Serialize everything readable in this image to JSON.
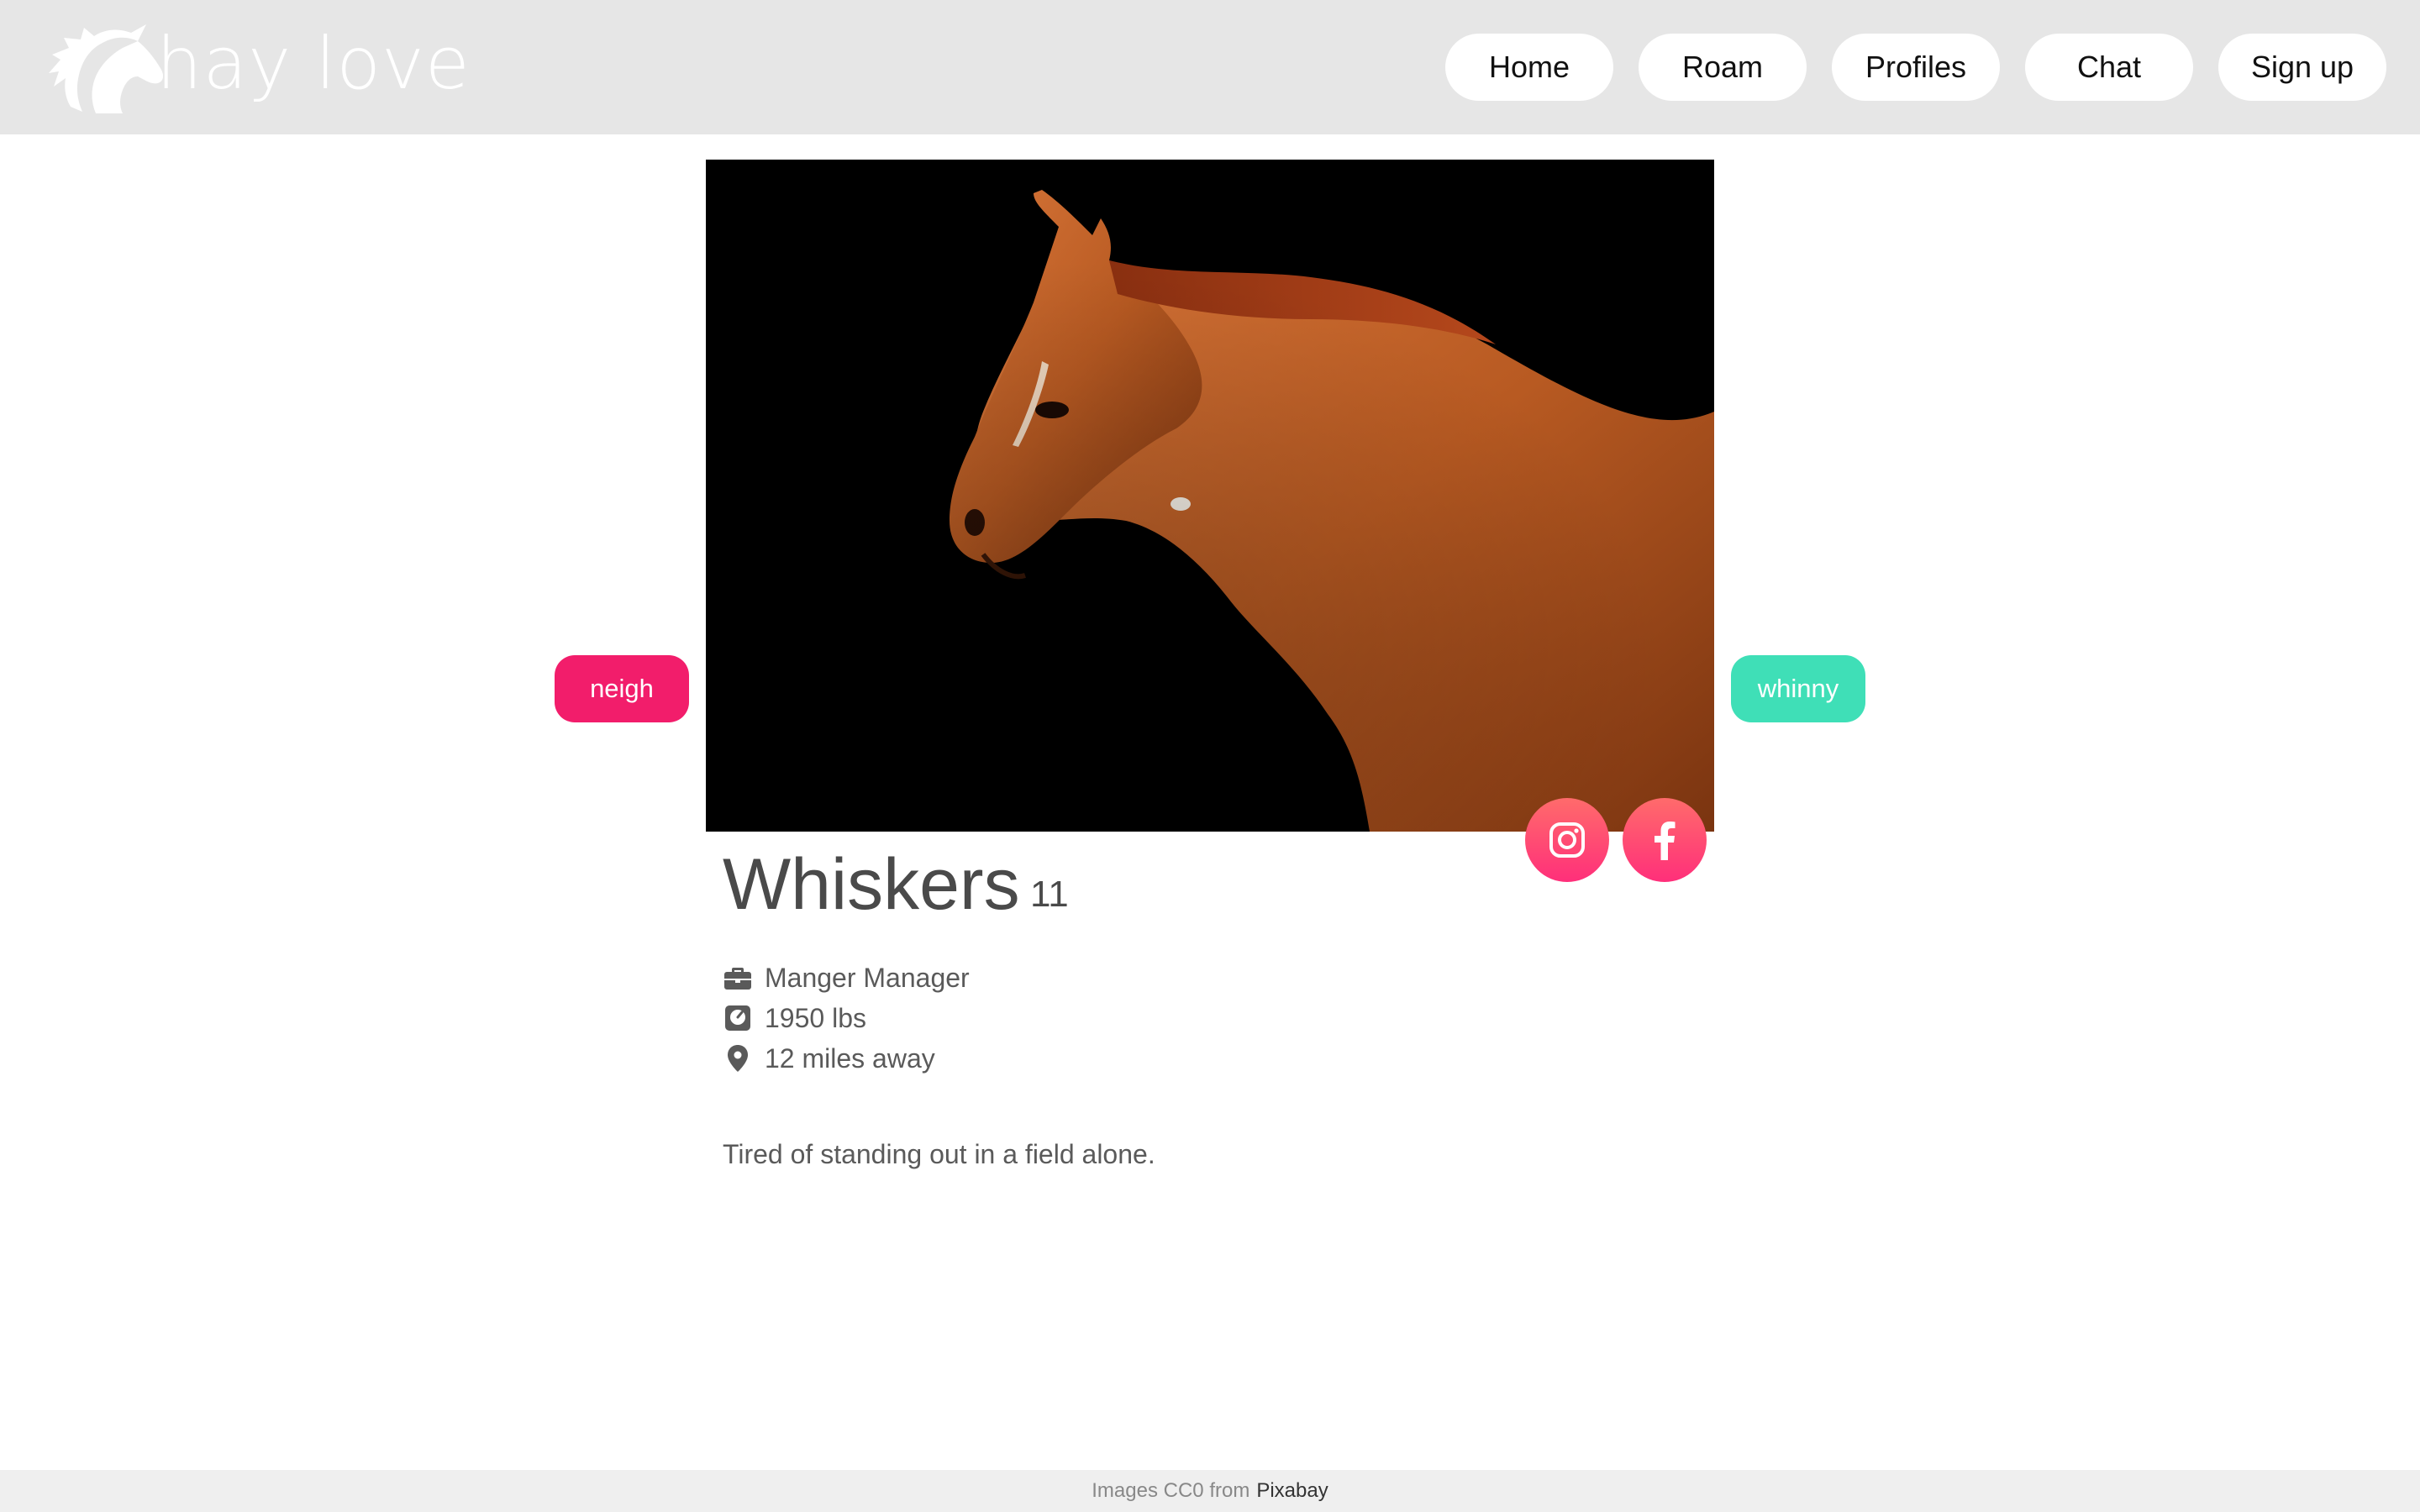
{
  "brand": {
    "name": "hay love",
    "logo_icon": "horse-head-icon"
  },
  "nav": {
    "items": [
      "Home",
      "Roam",
      "Profiles",
      "Chat",
      "Sign up"
    ]
  },
  "profile": {
    "name": "Whiskers",
    "age": "11",
    "job": "Manger Manager",
    "weight": "1950 lbs",
    "distance": "12 miles away",
    "bio": "Tired of standing out in a field alone.",
    "photo_icon": "chestnut-horse-photo"
  },
  "actions": {
    "reject_label": "neigh",
    "accept_label": "whinny"
  },
  "social": {
    "instagram_icon": "instagram-icon",
    "facebook_icon": "facebook-icon"
  },
  "footer": {
    "credit_text": "Images CC0 from",
    "credit_link": "Pixabay"
  },
  "colors": {
    "header_bg": "#e6e6e6",
    "reject": "#f21d6b",
    "accept": "#3fdfb7",
    "social_gradient_top": "#ff6b6b",
    "social_gradient_bottom": "#ff2f7a",
    "text": "#555555"
  }
}
